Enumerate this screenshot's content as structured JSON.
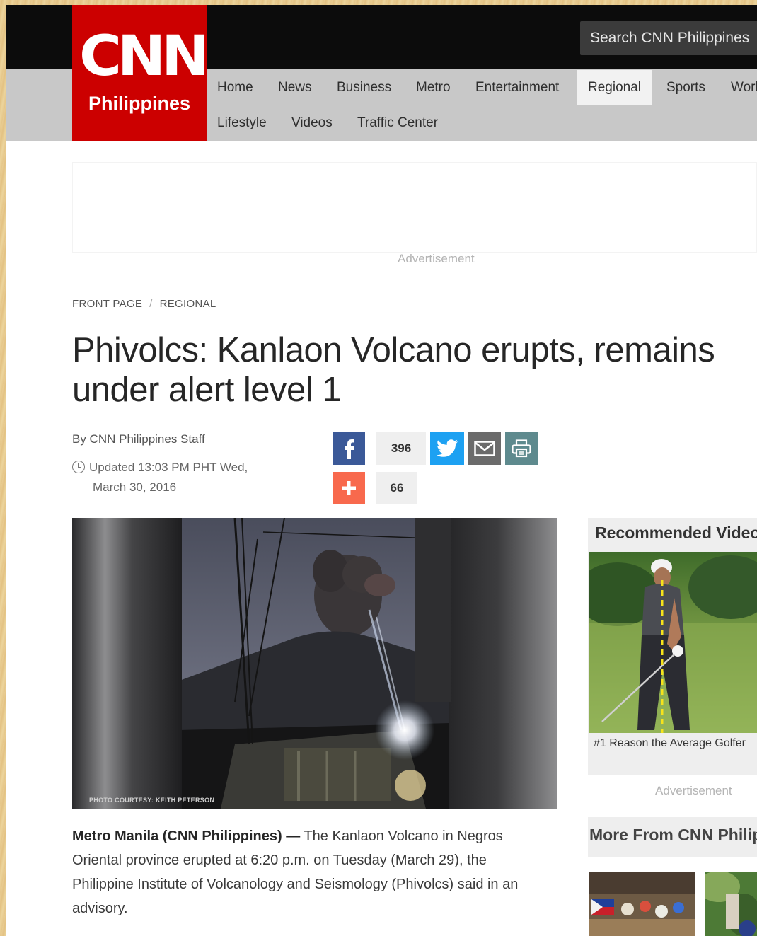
{
  "header": {
    "logo_main": "CNN",
    "logo_sub": "Philippines",
    "search_placeholder": "Search CNN Philippines",
    "nav_row1": [
      "Home",
      "News",
      "Business",
      "Metro",
      "Entertainment",
      "Regional",
      "Sports",
      "World"
    ],
    "nav_row2": [
      "Lifestyle",
      "Videos",
      "Traffic Center"
    ],
    "active_nav": "Regional"
  },
  "ads": {
    "top_label": "Advertisement",
    "sidebar_label": "Advertisement"
  },
  "article": {
    "breadcrumb": [
      "FRONT PAGE",
      "REGIONAL"
    ],
    "breadcrumb_separator": "/",
    "headline_line1": "Phivolcs: Kanlaon Volcano erupts, remains",
    "headline_line2": "under alert level 1",
    "byline": "By CNN Philippines Staff",
    "updated_line1": "Updated 13:03 PM PHT Wed,",
    "updated_line2": "March 30, 2016",
    "photo_credit": "PHOTO COURTESY: KEITH PETERSON",
    "lede_dateline": "Metro Manila (CNN Philippines)",
    "lede_dash": "—",
    "lede_text": "The Kanlaon Volcano in Negros Oriental province erupted at 6:20 p.m. on Tuesday (March 29), the Philippine Institute of Volcanology and Seismology (Phivolcs) said in an advisory."
  },
  "share": {
    "facebook_count": "396",
    "addthis_count": "66",
    "colors": {
      "facebook": "#3b5998",
      "twitter": "#1da1f2",
      "email": "#6b6b6b",
      "print": "#5e8a8e",
      "addthis": "#f8694d"
    }
  },
  "sidebar": {
    "recommended_title": "Recommended Videos",
    "recommended_caption": "#1 Reason the Average Golfer",
    "more_title": "More From CNN Philippines"
  },
  "colors": {
    "brand_red": "#cc0000",
    "topbar": "#0c0c0c",
    "navbar": "#c8c8c8"
  }
}
